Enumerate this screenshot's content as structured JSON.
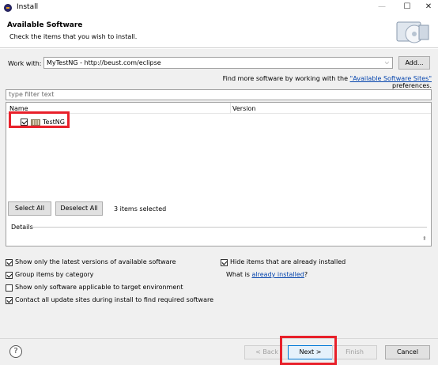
{
  "window": {
    "title": "Install",
    "min": "—",
    "max": "☐",
    "close": "✕"
  },
  "header": {
    "title": "Available Software",
    "subtitle": "Check the items that you wish to install."
  },
  "workwith": {
    "label": "Work with:",
    "value": "MyTestNG - http://beust.com/eclipse",
    "arrow": "⌵",
    "add_label": "Add..."
  },
  "findmore": {
    "prefix": "Find more software by working with the ",
    "link": "\"Available Software Sites\"",
    "suffix": " preferences."
  },
  "filter": {
    "placeholder": "type filter text"
  },
  "tree": {
    "columns": {
      "name": "Name",
      "version": "Version"
    },
    "rows": [
      {
        "label": "TestNG",
        "checked": true
      }
    ]
  },
  "selection": {
    "select_all": "Select All",
    "deselect_all": "Deselect All",
    "status": "3 items selected"
  },
  "details": {
    "label": "Details",
    "scroll": "⬍"
  },
  "options": {
    "latest": "Show only the latest versions of available software",
    "group": "Group items by category",
    "applicable": "Show only software applicable to target environment",
    "contact": "Contact all update sites during install to find required software",
    "hide": "Hide items that are already installed",
    "whatis_prefix": "What is ",
    "whatis_link": "already installed",
    "whatis_suffix": "?"
  },
  "footer": {
    "help": "?",
    "back": "< Back",
    "next": "Next >",
    "finish": "Finish",
    "cancel": "Cancel"
  },
  "colors": {
    "highlight": "#e8202a",
    "link": "#0645ad",
    "focus": "#0078d7"
  }
}
